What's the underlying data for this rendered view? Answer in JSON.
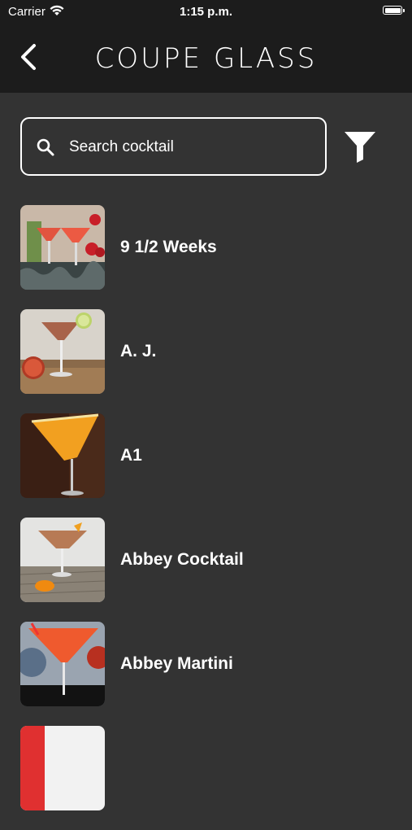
{
  "status_bar": {
    "carrier": "Carrier",
    "time": "1:15 p.m."
  },
  "nav": {
    "title": "COUPE GLASS"
  },
  "search": {
    "placeholder": "Search cocktail",
    "value": ""
  },
  "cocktails": [
    {
      "name": "9 1/2 Weeks"
    },
    {
      "name": "A. J."
    },
    {
      "name": "A1"
    },
    {
      "name": "Abbey Cocktail"
    },
    {
      "name": "Abbey Martini"
    }
  ]
}
